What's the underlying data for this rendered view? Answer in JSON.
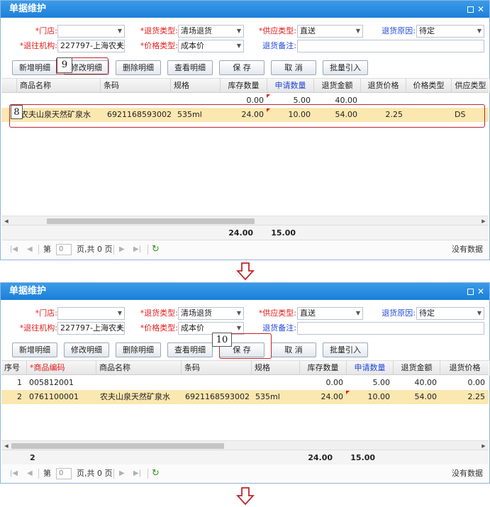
{
  "panel1": {
    "title": "单据维护",
    "form": {
      "store_label": "*门店:",
      "store_value": "",
      "return_type_label": "*退货类型:",
      "return_type_value": "清场退货",
      "supply_type_label": "*供应类型:",
      "supply_type_value": "直送",
      "return_reason_label": "退货原因:",
      "return_reason_value": "待定",
      "return_org_label": "*退往机构:",
      "return_org_value": "227797-上海农夫",
      "price_type_label": "*价格类型:",
      "price_type_value": "成本价",
      "return_note_label": "退货备注:",
      "return_note_value": ""
    },
    "buttons": {
      "add": "新增明细",
      "edit": "修改明细",
      "delete": "删除明细",
      "view": "查看明细",
      "save": "保 存",
      "cancel": "取 消",
      "batch": "批量引入"
    },
    "columns": [
      "商品名称",
      "条码",
      "规格",
      "库存数量",
      "申请数量",
      "退货金额",
      "退货价格",
      "价格类型",
      "供应类型"
    ],
    "rows": [
      {
        "name": "",
        "barcode": "",
        "spec": "",
        "stock": "0.00",
        "apply": "5.00",
        "amount": "40.00",
        "price": "",
        "price_type": "",
        "supply": ""
      },
      {
        "name": "农夫山泉天然矿泉水",
        "barcode": "6921168593002",
        "spec": "535ml",
        "stock": "24.00",
        "apply": "10.00",
        "amount": "54.00",
        "price": "2.25",
        "price_type": "",
        "supply": "DS"
      }
    ],
    "summary": {
      "stock": "24.00",
      "apply": "15.00"
    },
    "pager": {
      "page_label": "第",
      "page_value": "0",
      "total_label": "页,共 0 页",
      "empty": "没有数据"
    },
    "callouts": {
      "row": "8",
      "edit": "9"
    }
  },
  "panel2": {
    "title": "单据维护",
    "form": {
      "store_label": "*门店:",
      "store_value": "",
      "return_type_label": "*退货类型:",
      "return_type_value": "清场退货",
      "supply_type_label": "*供应类型:",
      "supply_type_value": "直送",
      "return_reason_label": "退货原因:",
      "return_reason_value": "待定",
      "return_org_label": "*退往机构:",
      "return_org_value": "227797-上海农夫",
      "price_type_label": "*价格类型:",
      "price_type_value": "成本价",
      "return_note_label": "退货备注:",
      "return_note_value": ""
    },
    "buttons": {
      "add": "新增明细",
      "edit": "修改明细",
      "delete": "删除明细",
      "view": "查看明细",
      "save": "保 存",
      "cancel": "取 消",
      "batch": "批量引入"
    },
    "columns": [
      "序号",
      "*商品编码",
      "商品名称",
      "条码",
      "规格",
      "库存数量",
      "申请数量",
      "退货金额",
      "退货价格"
    ],
    "rows": [
      {
        "seq": "1",
        "code": "005812001",
        "name": "",
        "barcode": "",
        "spec": "",
        "stock": "0.00",
        "apply": "5.00",
        "amount": "40.00",
        "price": "0.00"
      },
      {
        "seq": "2",
        "code": "0761100001",
        "name": "农夫山泉天然矿泉水",
        "barcode": "6921168593002",
        "spec": "535ml",
        "stock": "24.00",
        "apply": "10.00",
        "amount": "54.00",
        "price": "2.25"
      }
    ],
    "summary": {
      "count": "2",
      "stock": "24.00",
      "apply": "15.00"
    },
    "pager": {
      "page_label": "第",
      "page_value": "0",
      "total_label": "页,共 0 页",
      "empty": "没有数据"
    },
    "callouts": {
      "save": "10"
    }
  },
  "colors": {
    "title_bar": "#1b80d9",
    "highlight_row": "#fbe7b0",
    "required": "#e41c1c",
    "blue_label": "#1f48d8",
    "callout": "#c0262c"
  },
  "icons": [
    "maximize-icon",
    "close-icon",
    "dropdown-arrow-icon",
    "first-page-icon",
    "prev-page-icon",
    "next-page-icon",
    "last-page-icon",
    "refresh-icon",
    "down-arrow-icon"
  ]
}
